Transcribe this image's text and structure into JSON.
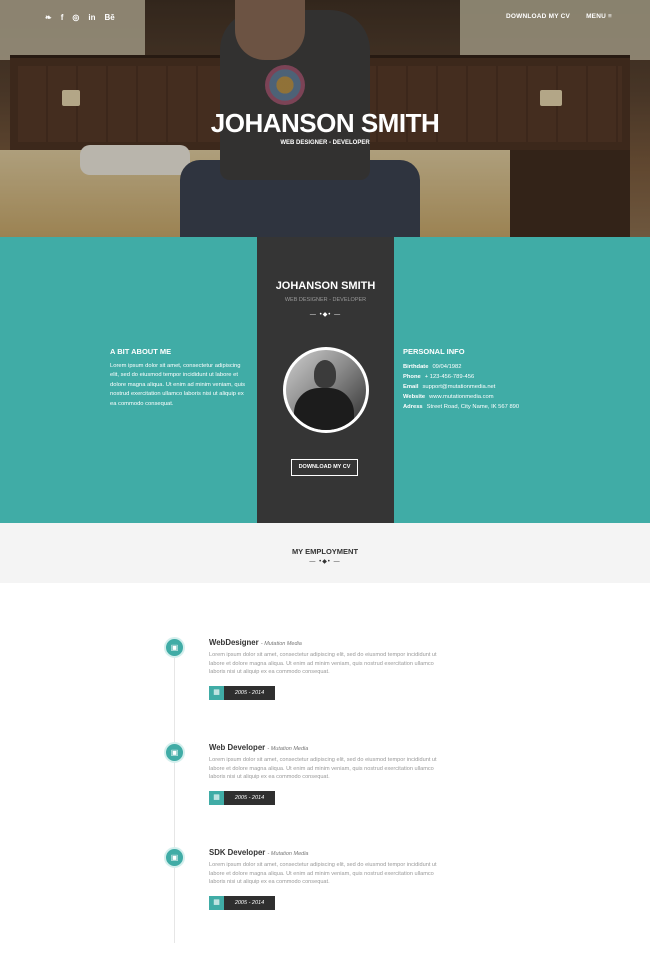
{
  "nav": {
    "social": [
      "twitter-icon",
      "facebook-icon",
      "instagram-icon",
      "linkedin-icon",
      "behance-icon"
    ],
    "social_glyphs": [
      "❧",
      "f",
      "◎",
      "in",
      "Bē"
    ],
    "download_label": "DOWNLOAD MY CV",
    "menu_label": "MENU ≡"
  },
  "hero": {
    "name": "JOHANSON SMITH",
    "subtitle": "WEB DESIGNER - DEVELOPER"
  },
  "profile": {
    "name": "JOHANSON SMITH",
    "role": "WEB DESIGNER - DEVELOPER",
    "divider": "— •◆• —",
    "cv_button": "DOWNLOAD MY CV",
    "about_heading": "A BIT ABOUT ME",
    "about_text": "Lorem ipsum dolor sit amet, consectetur adipiscing elit, sed do eiusmod tempor incididunt ut labore et dolore magna aliqua. Ut enim ad minim veniam, quis nostrud exercitation ullamco laboris nisi ut aliquip ex ea commodo consequat.",
    "info_heading": "PERSONAL INFO",
    "info": [
      {
        "label": "Birthdate",
        "value": "09/04/1982"
      },
      {
        "label": "Phone",
        "value": "+ 123-456-789-456"
      },
      {
        "label": "Email",
        "value": "support@mutationmedia.net"
      },
      {
        "label": "Website",
        "value": "www.mutationmedia.com"
      },
      {
        "label": "Adress",
        "value": "Street Road, City Name, IK 567 890"
      }
    ]
  },
  "employment": {
    "title": "MY EMPLOYMENT",
    "divider": "— •◆• —",
    "jobs": [
      {
        "title": "WebDesigner",
        "company": "- Mutation Media",
        "description": "Lorem ipsum dolor sit amet, consectetur adipiscing elit, sed do eiusmod tempor incididunt ut labore et dolore magna aliqua. Ut enim ad minim veniam, quis nostrud exercitation ullamco laboris nisi ut aliquip ex ea commodo consequat.",
        "dates": "2005 - 2014"
      },
      {
        "title": "Web Developer",
        "company": "- Mutation Media",
        "description": "Lorem ipsum dolor sit amet, consectetur adipiscing elit, sed do eiusmod tempor incididunt ut labore et dolore magna aliqua. Ut enim ad minim veniam, quis nostrud exercitation ullamco laboris nisi ut aliquip ex ea commodo consequat.",
        "dates": "2005 - 2014"
      },
      {
        "title": "SDK Developer",
        "company": "- Mutation Media",
        "description": "Lorem ipsum dolor sit amet, consectetur adipiscing elit, sed do eiusmod tempor incididunt ut labore et dolore magna aliqua. Ut enim ad minim veniam, quis nostrud exercitation ullamco laboris nisi ut aliquip ex ea commodo consequat.",
        "dates": "2005 - 2014"
      }
    ],
    "job_icon_glyph": "▣",
    "calendar_glyph": "▦"
  },
  "colors": {
    "accent": "#40aca6",
    "dark_panel": "#353535",
    "light_band": "#f4f4f4"
  }
}
